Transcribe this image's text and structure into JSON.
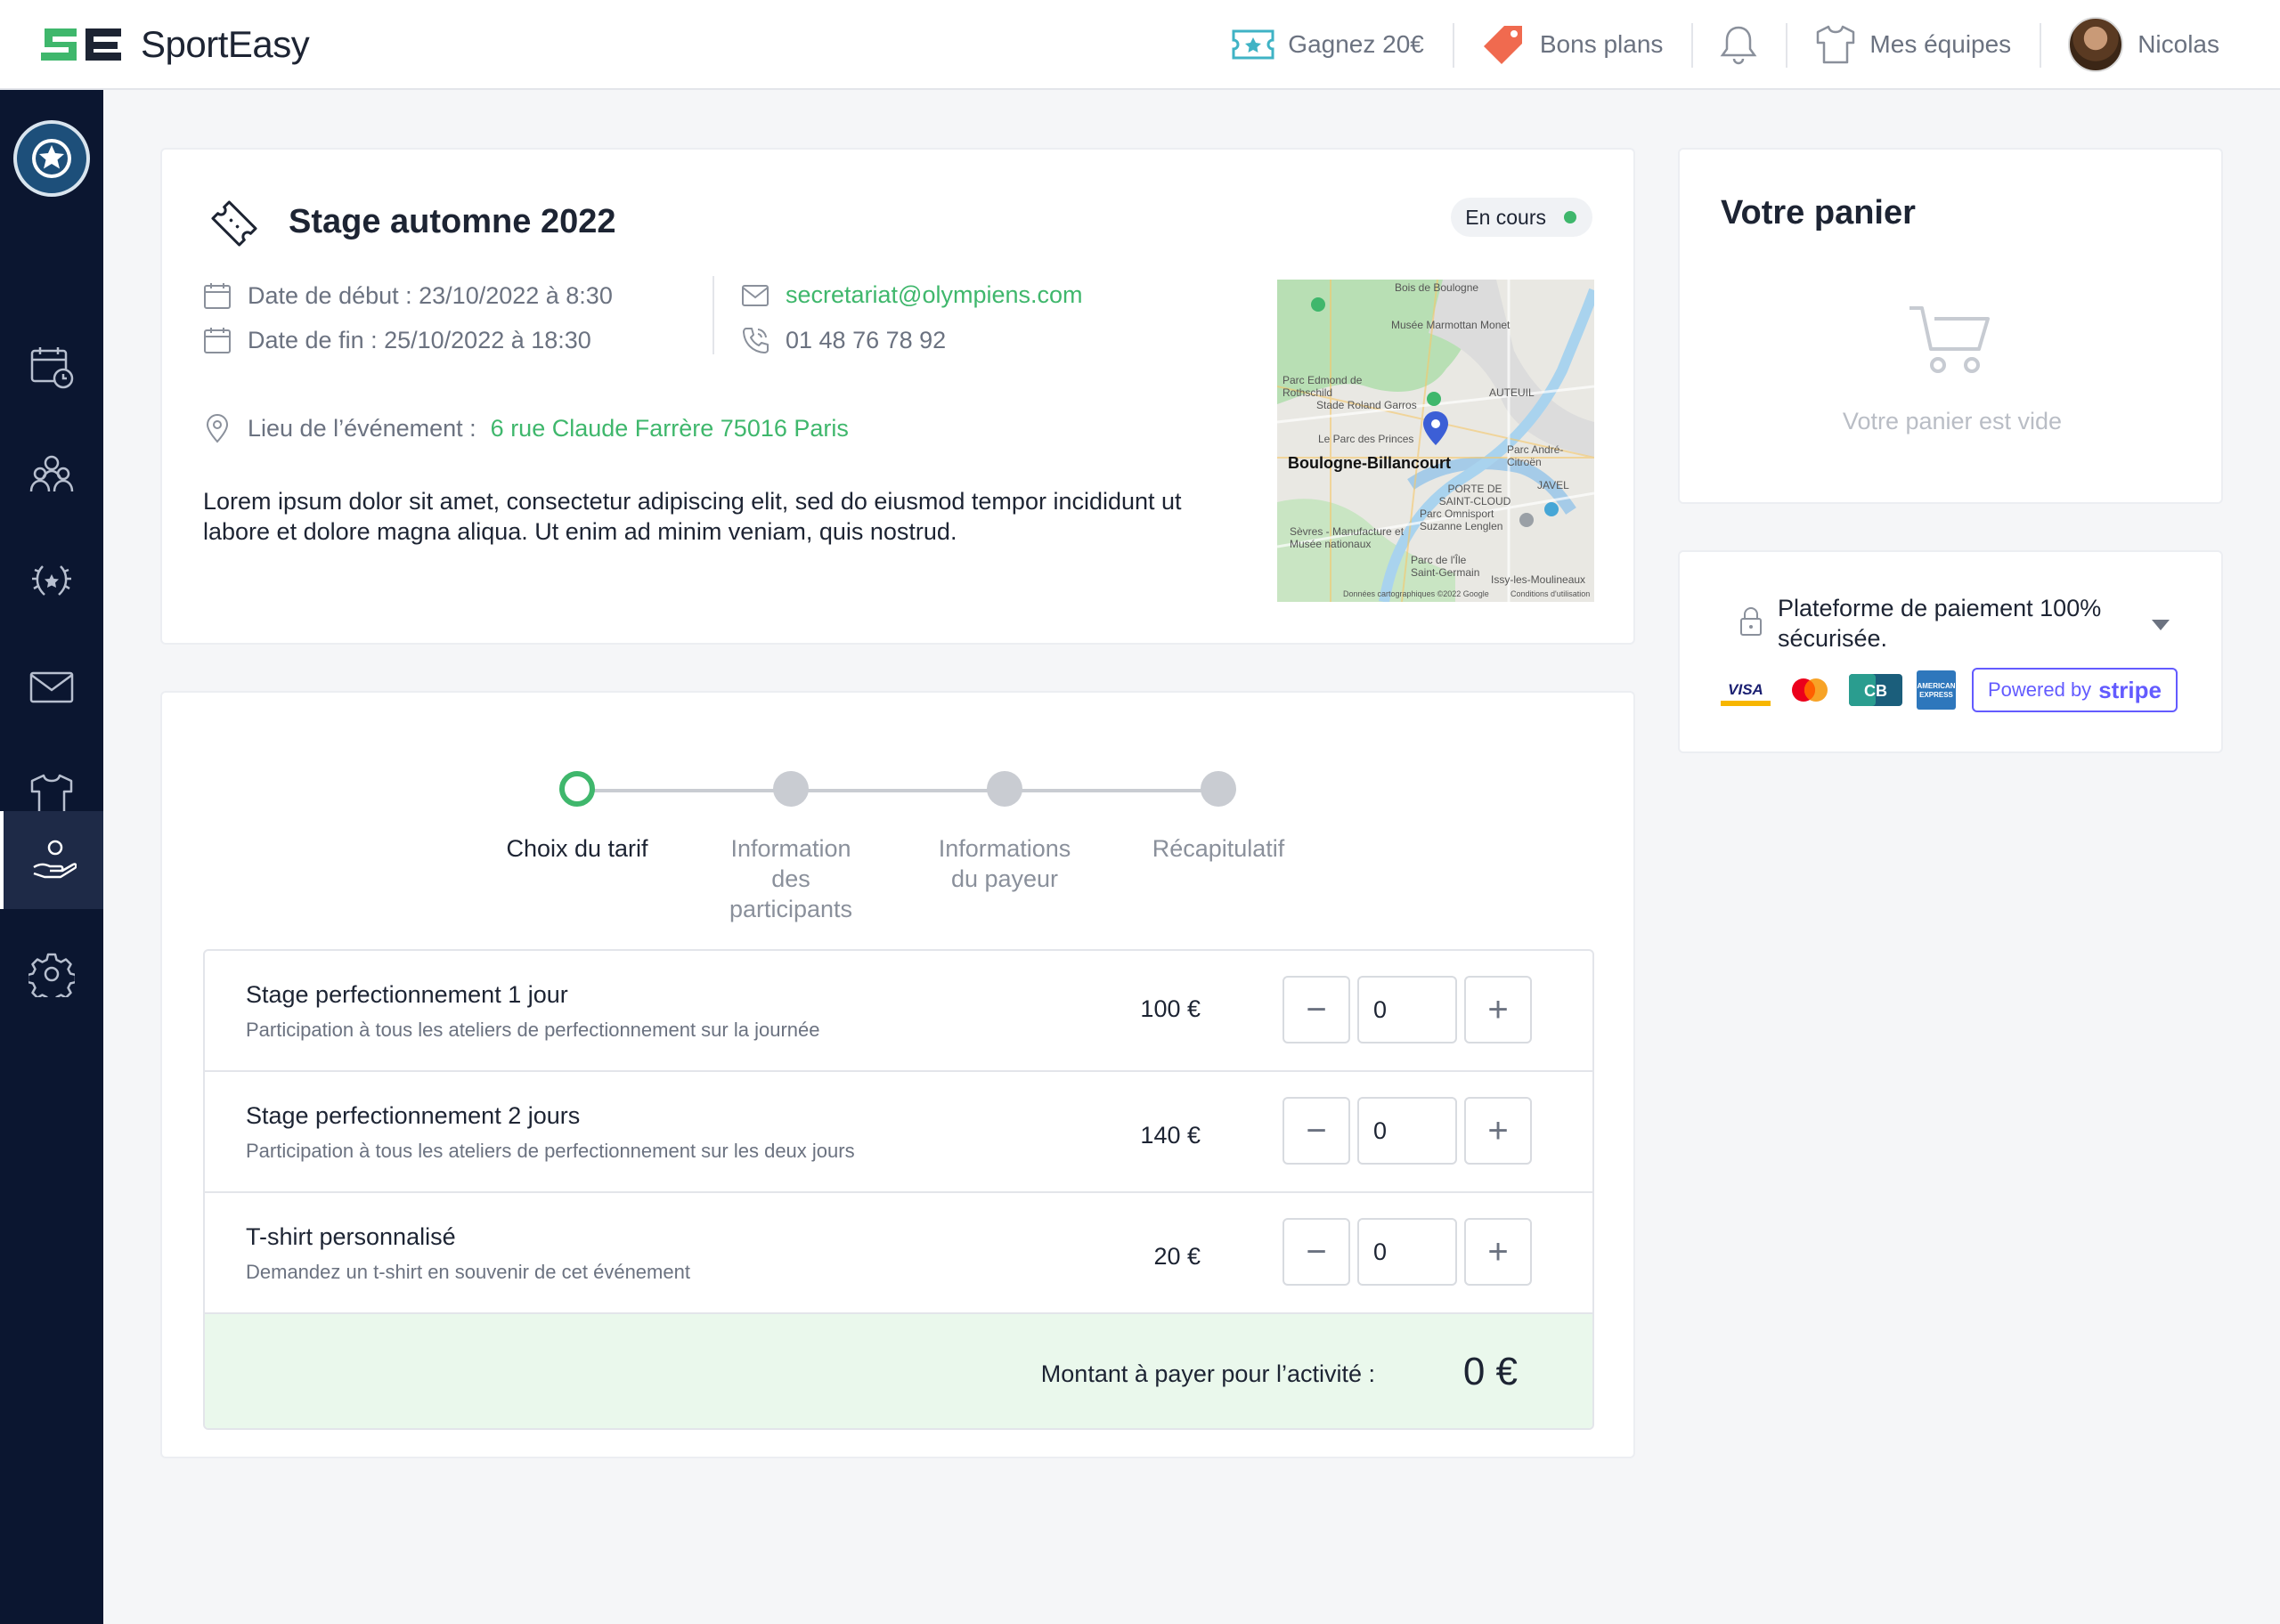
{
  "app": {
    "name": "SportEasy"
  },
  "topnav": {
    "reward_label": "Gagnez 20€",
    "deals_label": "Bons plans",
    "teams_label": "Mes équipes",
    "user_name": "Nicolas"
  },
  "event": {
    "title": "Stage automne 2022",
    "status": "En cours",
    "start_date": "Date de début : 23/10/2022 à 8:30",
    "end_date": "Date de fin : 25/10/2022 à 18:30",
    "email": "secretariat@olympiens.com",
    "phone": "01 48 76 78 92",
    "location_label": "Lieu de l’événement :",
    "location_value": "6 rue Claude Farrère 75016 Paris",
    "description": "Lorem ipsum dolor sit amet, consectetur adipiscing elit, sed do eiusmod tempor incididunt ut labore et dolore magna aliqua. Ut enim ad minim veniam, quis nostrud."
  },
  "map": {
    "labels": [
      "Bois de Boulogne",
      "Musée Marmottan Monet",
      "Parc Edmond de Rothschild",
      "Stade Roland Garros",
      "AUTEUIL",
      "Le Parc des Princes",
      "Boulogne-Billancourt",
      "Parc André-Citroën",
      "PORTE DE SAINT-CLOUD",
      "JAVEL",
      "Parc Omnisport Suzanne Lenglen",
      "Sèvres - Manufacture et Musée nationaux",
      "Parc de l'Île Saint-Germain",
      "Issy-les-Moulineaux",
      "Données cartographiques ©2022 Google",
      "Conditions d'utilisation"
    ]
  },
  "steps": [
    {
      "label": "Choix du tarif",
      "active": true
    },
    {
      "label": "Information des participants",
      "active": false
    },
    {
      "label": "Informations du payeur",
      "active": false
    },
    {
      "label": "Récapitulatif",
      "active": false
    }
  ],
  "tarifs": [
    {
      "name": "Stage perfectionnement 1 jour",
      "desc": "Participation à tous les ateliers de perfectionnement sur la journée",
      "price": "100 €",
      "qty": "0"
    },
    {
      "name": "Stage perfectionnement 2 jours",
      "desc": "Participation à tous les ateliers de perfectionnement sur les deux jours",
      "price": "140 €",
      "qty": "0"
    },
    {
      "name": "T-shirt personnalisé",
      "desc": "Demandez un t-shirt en souvenir de cet événement",
      "price": "20 €",
      "qty": "0"
    }
  ],
  "total": {
    "label": "Montant à payer pour l’activité :",
    "value": "0 €"
  },
  "cart": {
    "title": "Votre panier",
    "empty_text": "Votre panier est vide"
  },
  "payment": {
    "text": "Plateforme de paiement 100% sécurisée.",
    "stripe_prefix": "Powered by",
    "stripe_brand": "stripe"
  },
  "colors": {
    "accent": "#3fb76c",
    "sidebar": "#0b1630",
    "stripe": "#635bff"
  }
}
